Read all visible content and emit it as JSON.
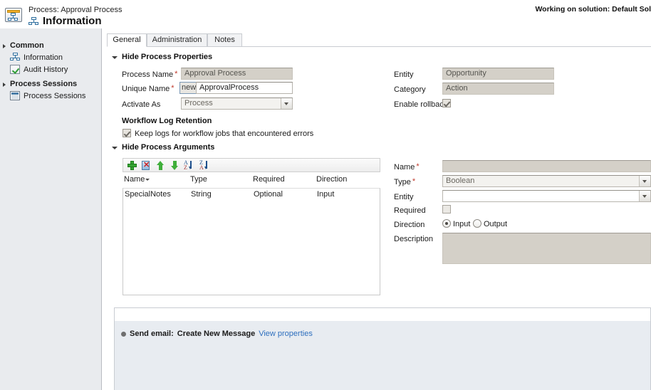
{
  "header": {
    "breadcrumb": "Process: Approval Process",
    "title": "Information",
    "solution_status": "Working on solution: Default Sol",
    "process_icon": "process-flow-icon",
    "title_icon": "process-flow-small-icon"
  },
  "sidebar": {
    "groups": [
      {
        "label": "Common",
        "items": [
          {
            "label": "Information",
            "icon": "process-flow-small-icon"
          },
          {
            "label": "Audit History",
            "icon": "audit-history-icon"
          }
        ]
      },
      {
        "label": "Process Sessions",
        "items": [
          {
            "label": "Process Sessions",
            "icon": "process-sessions-icon"
          }
        ]
      }
    ]
  },
  "tabs": [
    {
      "label": "General",
      "active": true
    },
    {
      "label": "Administration",
      "active": false
    },
    {
      "label": "Notes",
      "active": false
    }
  ],
  "process_properties": {
    "section_label": "Hide Process Properties",
    "fields": {
      "process_name_label": "Process Name",
      "process_name_value": "Approval Process",
      "unique_name_label": "Unique Name",
      "unique_name_prefix": "new_",
      "unique_name_value": "ApprovalProcess",
      "activate_as_label": "Activate As",
      "activate_as_value": "Process",
      "entity_label": "Entity",
      "entity_value": "Opportunity",
      "category_label": "Category",
      "category_value": "Action",
      "enable_rollback_label": "Enable rollback",
      "enable_rollback_checked": true
    },
    "log_retention": {
      "heading": "Workflow Log Retention",
      "checkbox_label": "Keep logs for workflow jobs that encountered errors",
      "checked": true
    }
  },
  "process_arguments": {
    "section_label": "Hide Process Arguments",
    "toolbar": [
      {
        "name": "add-argument-button",
        "icon": "plus-icon"
      },
      {
        "name": "delete-argument-button",
        "icon": "delete-icon"
      },
      {
        "name": "move-up-button",
        "icon": "arrow-up-icon"
      },
      {
        "name": "move-down-button",
        "icon": "arrow-down-icon"
      },
      {
        "name": "sort-ascending-button",
        "icon": "sort-az-icon"
      },
      {
        "name": "sort-descending-button",
        "icon": "sort-za-icon"
      }
    ],
    "columns": [
      "Name",
      "Type",
      "Required",
      "Direction"
    ],
    "sorted_column": "Name",
    "rows": [
      {
        "name": "SpecialNotes",
        "type": "String",
        "required": "Optional",
        "direction": "Input"
      }
    ],
    "detail": {
      "name_label": "Name",
      "name_value": "",
      "type_label": "Type",
      "type_value": "Boolean",
      "entity_label": "Entity",
      "entity_value": "",
      "required_label": "Required",
      "required_checked": false,
      "direction_label": "Direction",
      "direction_input_label": "Input",
      "direction_output_label": "Output",
      "direction_selected": "Input",
      "description_label": "Description",
      "description_value": ""
    }
  },
  "workflow_designer": {
    "steps": [
      {
        "label": "Send email:",
        "value": "Create New Message",
        "link": "View properties"
      }
    ]
  },
  "colors": {
    "sidebar_bg": "#e9ebee",
    "readonly_field": "#d4d0c8",
    "link": "#2e6fbe",
    "required_star": "#c0392b",
    "designer_bg": "#e8ecf1"
  }
}
